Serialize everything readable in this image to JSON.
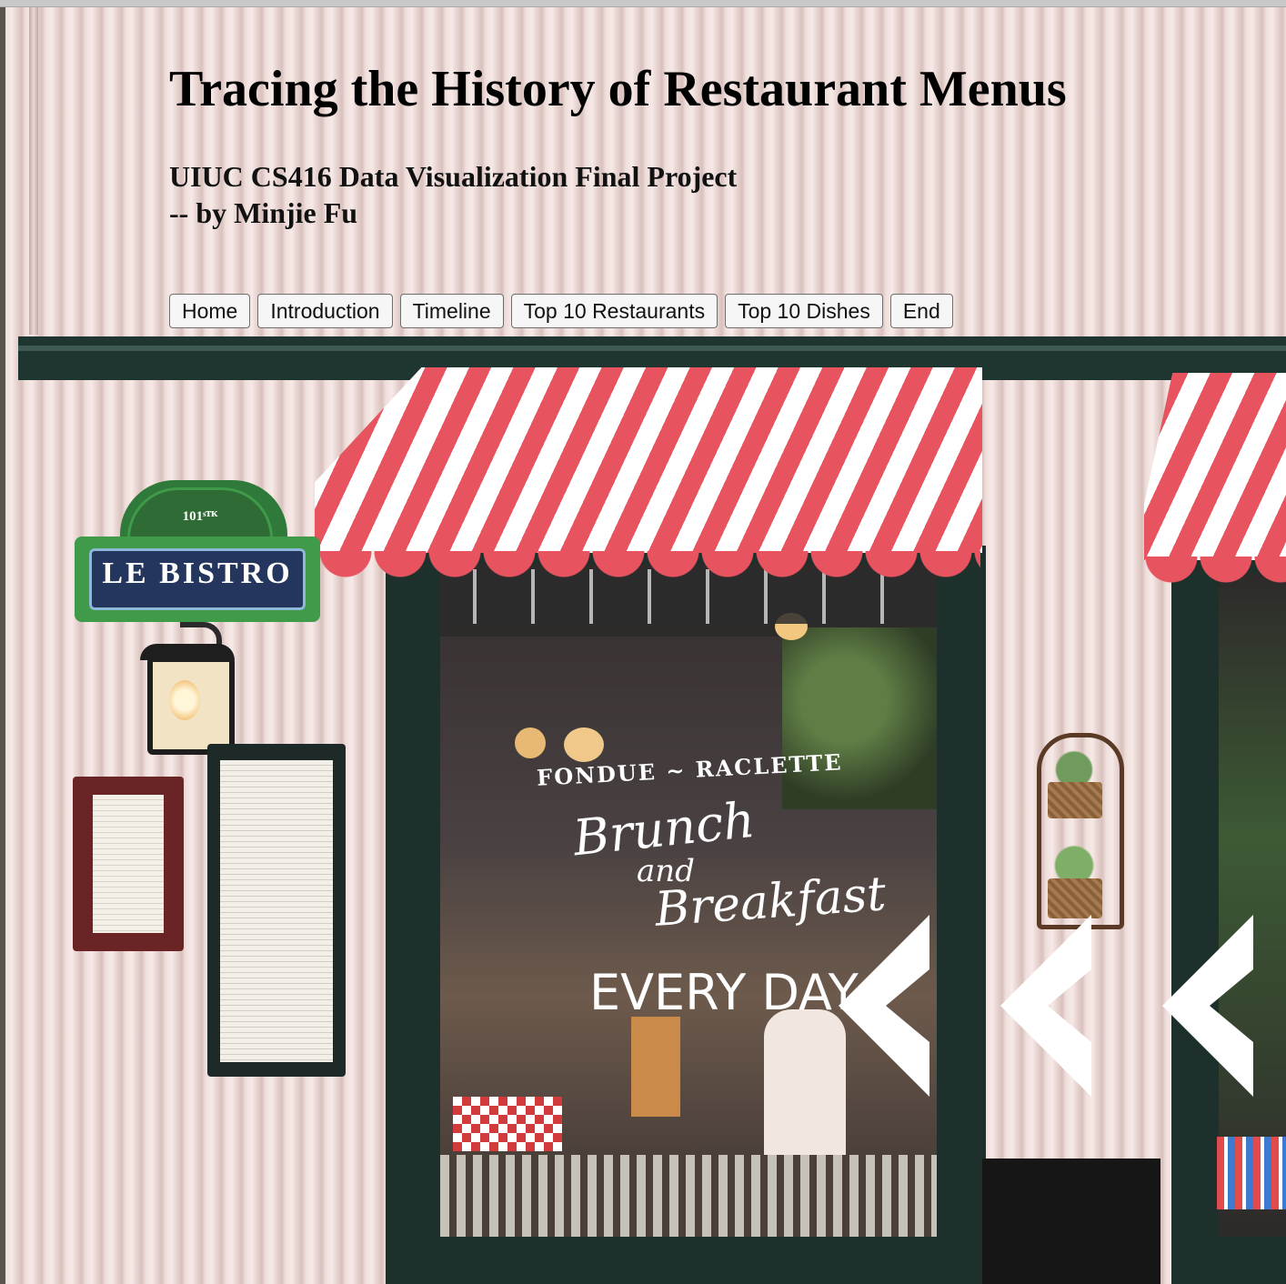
{
  "page": {
    "title": "Tracing the History of Restaurant Menus",
    "subtitle_line1": "UIUC CS416 Data Visualization Final Project",
    "subtitle_line2": "-- by Minjie Fu"
  },
  "nav": {
    "items": [
      {
        "label": "Home"
      },
      {
        "label": "Introduction"
      },
      {
        "label": "Timeline"
      },
      {
        "label": "Top 10 Restaurants"
      },
      {
        "label": "Top 10 Dishes"
      },
      {
        "label": "End"
      }
    ]
  },
  "background": {
    "sign_number": "101ˢᵀᴷ",
    "sign_name": "LE BISTRO",
    "window_line1": "FONDUE ~ RACLETTE",
    "window_line2": "Brunch",
    "window_line3": "and",
    "window_line4": "Breakfast",
    "window_line5": "EVERY DAY"
  },
  "colors": {
    "awning_red": "#e7535f",
    "frame_green": "#1d302b",
    "sign_green": "#3f9a4a",
    "sign_blue": "#24365e"
  },
  "icons": {
    "chevrons": [
      "chevron-left-icon",
      "chevron-left-icon",
      "chevron-left-icon"
    ]
  }
}
